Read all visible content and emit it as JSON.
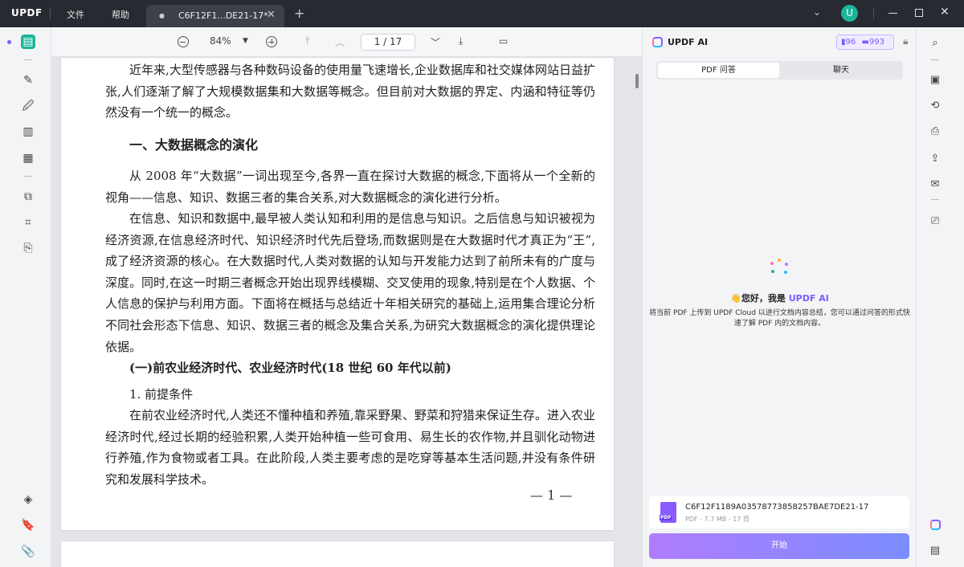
{
  "app": {
    "logo_main": "UPDF",
    "menu_file": "文件",
    "menu_help": "帮助",
    "tab_title": "C6F12F1...DE21-17*",
    "user_initial": "U"
  },
  "viewer": {
    "zoom": "84%",
    "page_indicator": "1  /  17"
  },
  "document": {
    "para1": "近年来,大型传感器与各种数码设备的使用量飞速增长,企业数据库和社交媒体网站日益扩张,人们逐渐了解了大规模数据集和大数据等概念。但目前对大数据的界定、内涵和特征等仍然没有一个统一的概念。",
    "heading1": "一、大数据概念的演化",
    "para2": "从 2008 年“大数据”一词出现至今,各界一直在探讨大数据的概念,下面将从一个全新的视角——信息、知识、数据三者的集合关系,对大数据概念的演化进行分析。",
    "para3": "在信息、知识和数据中,最早被人类认知和利用的是信息与知识。之后信息与知识被视为经济资源,在信息经济时代、知识经济时代先后登场,而数据则是在大数据时代才真正为“王”,成了经济资源的核心。在大数据时代,人类对数据的认知与开发能力达到了前所未有的广度与深度。同时,在这一时期三者概念开始出现界线模糊、交叉使用的现象,特别是在个人数据、个人信息的保护与利用方面。下面将在概括与总结近十年相关研究的基础上,运用集合理论分析不同社会形态下信息、知识、数据三者的概念及集合关系,为研究大数据概念的演化提供理论依据。",
    "heading2": "(一)前农业经济时代、农业经济时代(18 世纪 60 年代以前)",
    "heading3": "1. 前提条件",
    "para4": "在前农业经济时代,人类还不懂种植和养殖,靠采野果、野菜和狩猎来保证生存。进入农业经济时代,经过长期的经验积累,人类开始种植一些可食用、易生长的农作物,并且驯化动物进行养殖,作为食物或者工具。在此阶段,人类主要考虑的是吃穿等基本生活问题,并没有条件研究和发展科学技术。",
    "page_number": "— 1 —"
  },
  "ai_panel": {
    "title": "UPDF AI",
    "badge_a": "96",
    "badge_b": "993",
    "tab_qa": "PDF 问答",
    "tab_chat": "聊天",
    "greet_prefix": "👋您好，我是 ",
    "greet_name": "UPDF AI",
    "description": "将当前 PDF 上传到 UPDF Cloud 以进行文档内容总结，您可以通过问答的形式快速了解 PDF 内的文档内容。",
    "file_name": "C6F12F1189A03578773858257BAE7DE21-17",
    "file_meta": "PDF - 7.7 MB - 17 页",
    "file_badge": "PDF",
    "start_label": "开始"
  },
  "colors": {
    "accent": "#7b5cff",
    "active_tool": "#1bb59a"
  }
}
